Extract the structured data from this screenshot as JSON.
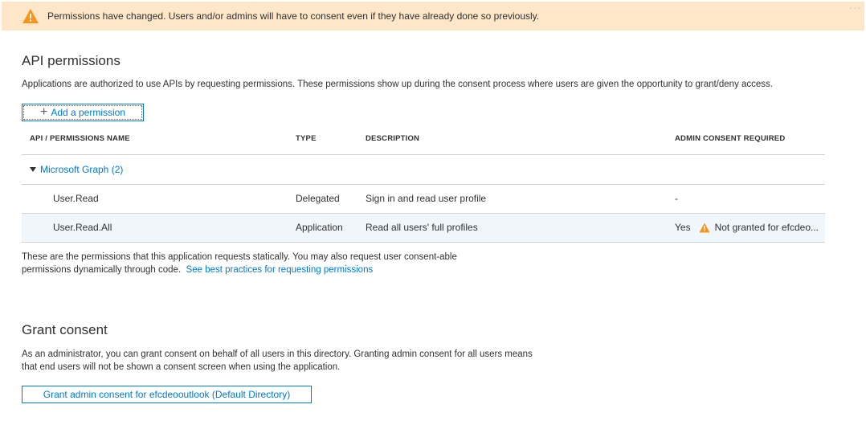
{
  "banner": {
    "message": "Permissions have changed. Users and/or admins will have to consent even if they have already done so previously.",
    "icon": "warning-icon",
    "more": "..."
  },
  "api_permissions": {
    "title": "API permissions",
    "description": "Applications are authorized to use APIs by requesting permissions. These permissions show up during the consent process where users are given the opportunity to grant/deny access.",
    "add_button": "Add a permission",
    "columns": [
      "API / PERMISSIONS NAME",
      "TYPE",
      "DESCRIPTION",
      "ADMIN CONSENT REQUIRED"
    ],
    "group": {
      "label": "Microsoft Graph (2)"
    },
    "rows": [
      {
        "name": "User.Read",
        "type": "Delegated",
        "description": "Sign in and read user profile",
        "consent": "-",
        "status": ""
      },
      {
        "name": "User.Read.All",
        "type": "Application",
        "description": "Read all users' full profiles",
        "consent": "Yes",
        "status": "Not granted for efcdeo..."
      }
    ],
    "footnote_line1": "These are the permissions that this application requests statically. You may also request user consent-able",
    "footnote_line2": "permissions dynamically through code.",
    "footnote_link": "See best practices for requesting permissions"
  },
  "grant_consent": {
    "title": "Grant consent",
    "description_line1": "As an administrator, you can grant consent on behalf of all users in this directory. Granting admin consent for all users means",
    "description_line2": "that end users will not be shown a consent screen when using the application.",
    "button": "Grant admin consent for efcdeooutlook (Default Directory)"
  },
  "colors": {
    "accent": "#0078d4",
    "warning": "#f7941d",
    "banner_bg": "#fde7c8"
  }
}
